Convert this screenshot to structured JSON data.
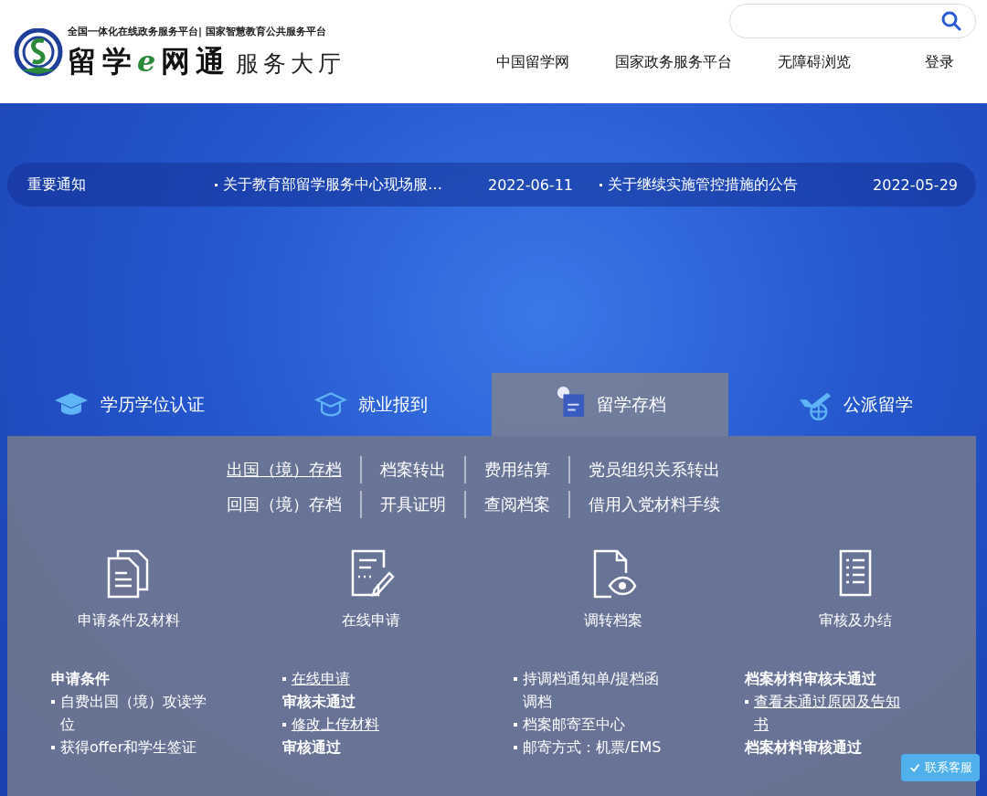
{
  "header": {
    "tagline": "全国一体化在线政务服务平台| 国家智慧教育公共服务平台",
    "brand": "留学",
    "brand_e": "e",
    "brand_rest": "网通",
    "subtitle": "服务大厅",
    "nav": [
      "中国留学网",
      "国家政务服务平台",
      "无障碍浏览",
      "登录"
    ]
  },
  "notice": {
    "label": "重要通知",
    "items": [
      {
        "title": "关于教育部留学服务中心现场服…",
        "date": "2022-06-11"
      },
      {
        "title": "关于继续实施管控措施的公告",
        "date": "2022-05-29"
      }
    ]
  },
  "tabs": [
    {
      "label": "学历学位认证",
      "selected": false
    },
    {
      "label": "就业报到",
      "selected": false
    },
    {
      "label": "留学存档",
      "selected": true
    },
    {
      "label": "公派留学",
      "selected": false
    }
  ],
  "subnav": [
    [
      {
        "label": "出国（境）存档",
        "selected": true
      },
      {
        "label": "档案转出",
        "selected": false
      },
      {
        "label": "费用结算",
        "selected": false
      },
      {
        "label": "党员组织关系转出",
        "selected": false
      }
    ],
    [
      {
        "label": "回国（境）存档",
        "selected": false
      },
      {
        "label": "开具证明",
        "selected": false
      },
      {
        "label": "查阅档案",
        "selected": false
      },
      {
        "label": "借用入党材料手续",
        "selected": false
      }
    ]
  ],
  "steps": [
    {
      "label": "申请条件及材料",
      "items": [
        {
          "kind": "heading",
          "text": "申请条件"
        },
        {
          "kind": "bullet",
          "text": "自费出国（境）攻读学位",
          "link": false
        },
        {
          "kind": "bullet",
          "text": "获得offer和学生签证",
          "link": false
        }
      ]
    },
    {
      "label": "在线申请",
      "items": [
        {
          "kind": "bullet",
          "text": "在线申请",
          "link": true
        },
        {
          "kind": "heading",
          "text": "审核未通过"
        },
        {
          "kind": "bullet",
          "text": "修改上传材料",
          "link": true
        },
        {
          "kind": "heading",
          "text": "审核通过"
        }
      ]
    },
    {
      "label": "调转档案",
      "items": [
        {
          "kind": "bullet",
          "text": "持调档通知单/提档函调档",
          "link": false
        },
        {
          "kind": "bullet",
          "text": "档案邮寄至中心",
          "link": false
        },
        {
          "kind": "bullet",
          "text": "邮寄方式：机票/EMS",
          "link": false
        }
      ]
    },
    {
      "label": "审核及办结",
      "items": [
        {
          "kind": "heading",
          "text": "档案材料审核未通过"
        },
        {
          "kind": "bullet",
          "text": "查看未通过原因及告知书",
          "link": true
        },
        {
          "kind": "heading",
          "text": "档案材料审核通过"
        }
      ]
    }
  ],
  "service_button": "联系客服"
}
